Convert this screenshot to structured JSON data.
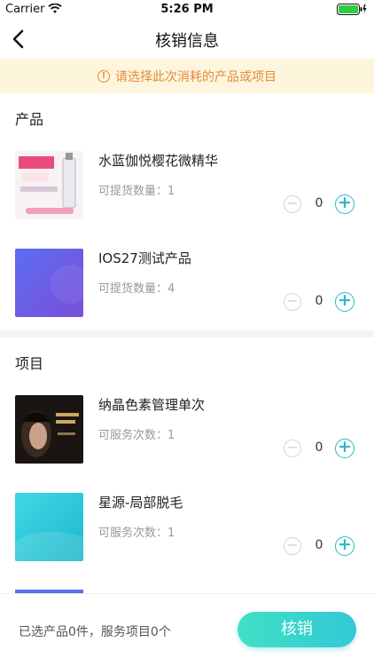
{
  "status_bar": {
    "carrier": "Carrier",
    "time": "5:26 PM"
  },
  "header": {
    "title": "核销信息"
  },
  "notice": {
    "text": "请选择此次消耗的产品或项目"
  },
  "products": {
    "title": "产品",
    "items": [
      {
        "name": "水蓝伽悦樱花微精华",
        "qty_label": "可提货数量：",
        "qty": "1",
        "count": "0"
      },
      {
        "name": "IOS27测试产品",
        "qty_label": "可提货数量：",
        "qty": "4",
        "count": "0"
      }
    ]
  },
  "services": {
    "title": "项目",
    "items": [
      {
        "name": "纳晶色素管理单次",
        "qty_label": "可服务次数：",
        "qty": "1",
        "count": "0"
      },
      {
        "name": "星源-局部脱毛",
        "qty_label": "可服务次数：",
        "qty": "1",
        "count": "0"
      }
    ]
  },
  "footer": {
    "summary": "已选产品0件，服务项目0个",
    "confirm_label": "核销"
  },
  "colors": {
    "accent": "#2bb8c9",
    "notice_bg": "#fdf6dd",
    "notice_text": "#e58a3a"
  }
}
